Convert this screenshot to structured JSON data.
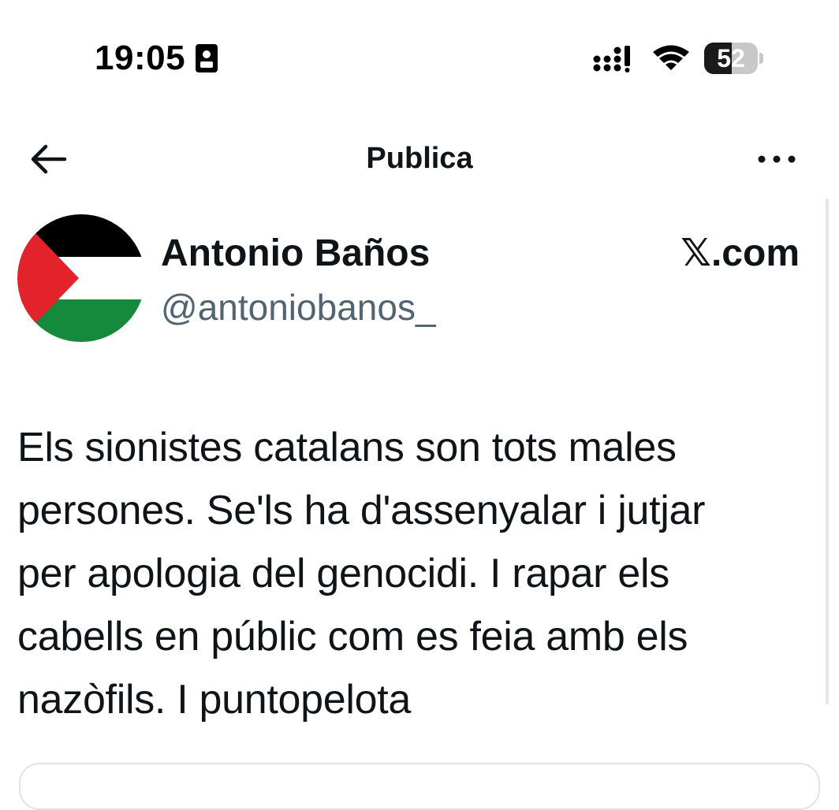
{
  "status_bar": {
    "time": "19:05",
    "battery_level": "52",
    "battery_fraction": 0.52
  },
  "header": {
    "title": "Publica",
    "back_icon": "arrow-left-icon",
    "more_icon": "more-dots-icon"
  },
  "author": {
    "display_name": "Antonio Baños",
    "handle": "@antoniobanos_",
    "avatar_description": "palestine-flag-avatar"
  },
  "source": {
    "label": "𝕏.com"
  },
  "tweet": {
    "lines": [
      "Els sionistes catalans son tots males",
      "persones. Se'ls ha d'assenyalar i jutjar",
      "per apologia del genocidi. I rapar els",
      "cabells en públic com es feia amb els",
      "nazòfils. I puntopelota"
    ]
  },
  "colors": {
    "text_primary": "#0f1419",
    "text_secondary": "#536471",
    "flag_black": "#000000",
    "flag_white": "#ffffff",
    "flag_green": "#168a3c",
    "flag_red": "#e3232b"
  }
}
